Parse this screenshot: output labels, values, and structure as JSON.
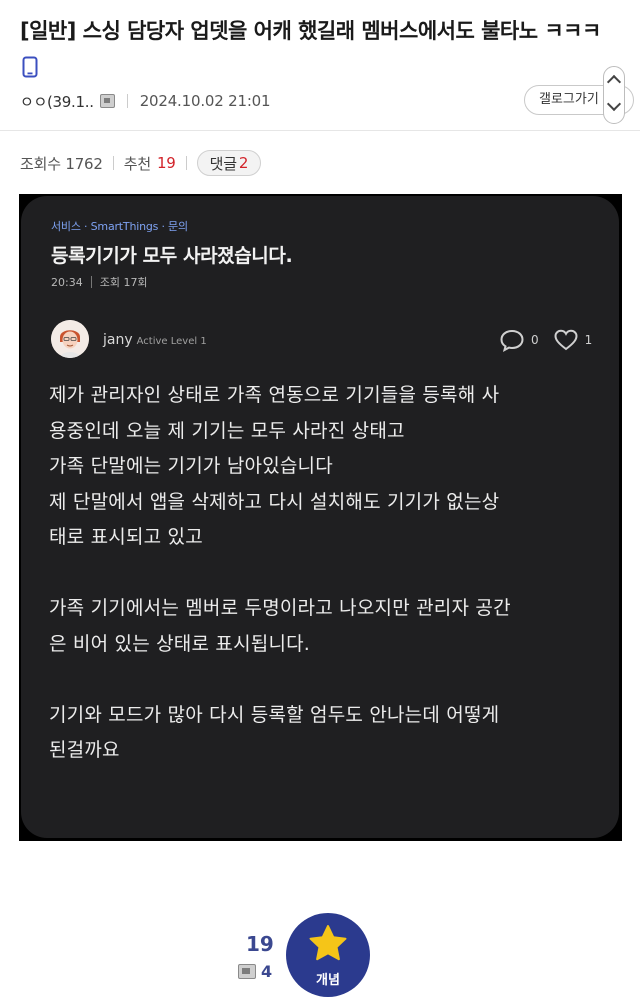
{
  "post": {
    "title": "[일반] 스싱 담당자 업뎃을 어캐 했길래 멤버스에서도 불타노 ㅋㅋㅋ",
    "author": "ㅇㅇ(39.1..",
    "date": "2024.10.02 21:01",
    "gallery_button": "갤로그가기",
    "views_label": "조회수 1762",
    "recommend_label": "추천",
    "recommend_value": "19",
    "comments_label": "댓글",
    "comments_value": "2"
  },
  "embedded": {
    "breadcrumb": "서비스 · SmartThings · 문의",
    "title": "등록기기가 모두 사라졌습니다.",
    "time": "20:34",
    "views": "조회 17회",
    "user": "jany",
    "level": "Active Level 1",
    "comment_count": "0",
    "like_count": "1",
    "body": "제가 관리자인 상태로 가족 연동으로 기기들을 등록해 사\n용중인데 오늘 제 기기는 모두 사라진 상태고\n가족 단말에는 기기가 남아있습니다\n제 단말에서 앱을 삭제하고 다시 설치해도 기기가 없는상\n태로 표시되고 있고\n\n가족 기기에서는 멤버로 두명이라고 나오지만 관리자 공간\n은 비어 있는 상태로 표시됩니다.\n\n기기와 모드가 많아 다시 등록할 엄두도 안나는데 어떻게\n된걸까요"
  },
  "footer": {
    "recommend_count": "19",
    "comment_count": "4",
    "upvote_label": "개념"
  },
  "icons": {
    "mobile": "mobile-phone-icon",
    "scroll": "scroll-up-down-icon",
    "comment": "comment-bubble-icon",
    "like": "heart-icon",
    "star": "star-icon"
  },
  "colors": {
    "accent_red": "#d2232a",
    "brand_navy": "#2b3a8e",
    "upvote_star": "#f5c518",
    "link_blue": "#7ea2f2"
  }
}
